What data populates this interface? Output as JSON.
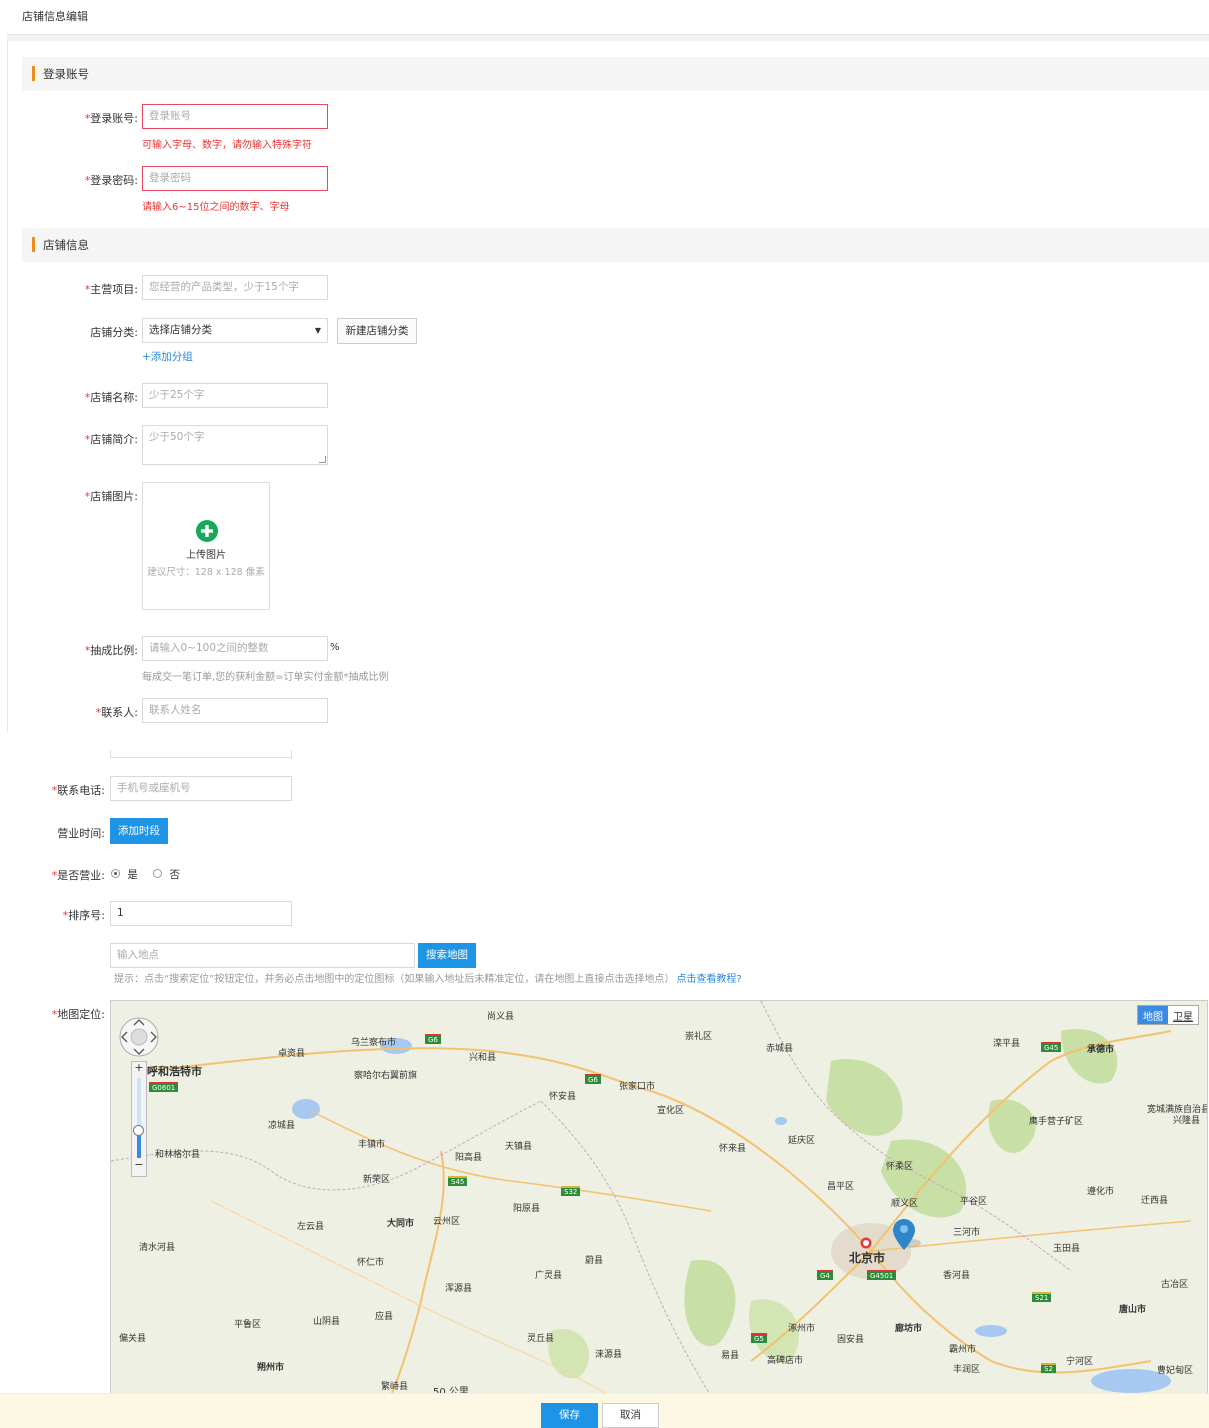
{
  "page": {
    "title": "店铺信息编辑"
  },
  "sections": {
    "login": "登录账号",
    "shop": "店铺信息"
  },
  "fields": {
    "login_account": {
      "label": "登录账号:",
      "placeholder": "登录账号",
      "hint": "可输入字母、数字，请勿输入特殊字符"
    },
    "login_password": {
      "label": "登录密码:",
      "placeholder": "登录密码",
      "hint": "请输入6~15位之间的数字、字母"
    },
    "main_project": {
      "label": "主营项目:",
      "placeholder": "您经营的产品类型，少于15个字"
    },
    "shop_category": {
      "label": "店铺分类:",
      "selected": "选择店铺分类",
      "new_button": "新建店铺分类",
      "add_group": "+添加分组"
    },
    "shop_name": {
      "label": "店铺名称:",
      "placeholder": "少于25个字"
    },
    "shop_intro": {
      "label": "店铺简介:",
      "placeholder": "少于50个字"
    },
    "shop_image": {
      "label": "店铺图片:",
      "upload": "上传图片",
      "size_hint": "建议尺寸：128 x 128 像素"
    },
    "commission": {
      "label": "抽成比例:",
      "placeholder": "请输入0~100之间的整数",
      "unit": "%",
      "hint": "每成交一笔订单,您的获利金额=订单实付金额*抽成比例"
    },
    "contact": {
      "label": "联系人:",
      "placeholder": "联系人姓名"
    },
    "phone": {
      "label": "联系电话:",
      "placeholder": "手机号或座机号"
    },
    "business_hours": {
      "label": "营业时间:",
      "button": "添加时段"
    },
    "is_open": {
      "label": "是否营业:",
      "yes": "是",
      "no": "否"
    },
    "sort": {
      "label": "排序号:",
      "value": "1"
    },
    "map_search": {
      "placeholder": "输入地点",
      "button": "搜索地图",
      "tip": "提示：点击“搜索定位”按钮定位，并务必点击地图中的定位图标（如果输入地址后未精准定位，请在地图上直接点击选择地点）",
      "tutorial": "点击查看教程?"
    },
    "map": {
      "label": "地图定位:"
    }
  },
  "map": {
    "type_map": "地图",
    "type_satellite": "卫星",
    "scale": "50 公里",
    "places": [
      {
        "name": "乌兰察布市"
      },
      {
        "name": "呼和浩特市"
      },
      {
        "name": "卓资县"
      },
      {
        "name": "兴和县"
      },
      {
        "name": "察哈尔右翼前旗"
      },
      {
        "name": "张家口市"
      },
      {
        "name": "怀安县"
      },
      {
        "name": "宣化区"
      },
      {
        "name": "崇礼区"
      },
      {
        "name": "赤城县"
      },
      {
        "name": "滦平县"
      },
      {
        "name": "承德市"
      },
      {
        "name": "凉城县"
      },
      {
        "name": "丰镇市"
      },
      {
        "name": "天镇县"
      },
      {
        "name": "阳高县"
      },
      {
        "name": "和林格尔县"
      },
      {
        "name": "新荣区"
      },
      {
        "name": "大同市"
      },
      {
        "name": "云州区"
      },
      {
        "name": "左云县"
      },
      {
        "name": "清水河县"
      },
      {
        "name": "怀仁市"
      },
      {
        "name": "浑源县"
      },
      {
        "name": "广灵县"
      },
      {
        "name": "蔚县"
      },
      {
        "name": "怀来县"
      },
      {
        "name": "延庆区"
      },
      {
        "name": "怀柔区"
      },
      {
        "name": "昌平区"
      },
      {
        "name": "顺义区"
      },
      {
        "name": "平谷区"
      },
      {
        "name": "三河市"
      },
      {
        "name": "北京市"
      },
      {
        "name": "香河县"
      },
      {
        "name": "玉田县"
      },
      {
        "name": "廊坊市"
      },
      {
        "name": "涿州市"
      },
      {
        "name": "固安县"
      },
      {
        "name": "霸州市"
      },
      {
        "name": "高碑店市"
      },
      {
        "name": "易县"
      },
      {
        "name": "涞源县"
      },
      {
        "name": "灵丘县"
      },
      {
        "name": "应县"
      },
      {
        "name": "山阴县"
      },
      {
        "name": "平鲁区"
      },
      {
        "name": "偏关县"
      },
      {
        "name": "朔州市"
      },
      {
        "name": "繁峙县"
      },
      {
        "name": "阳原县"
      },
      {
        "name": "遵化市"
      },
      {
        "name": "迁西县"
      },
      {
        "name": "唐山市"
      },
      {
        "name": "宁河区"
      },
      {
        "name": "丰润区"
      },
      {
        "name": "古冶区"
      },
      {
        "name": "尚义县"
      },
      {
        "name": "兴隆县"
      },
      {
        "name": "宽城满族自治县"
      },
      {
        "name": "鹰手营子矿区"
      },
      {
        "name": "曹妃甸区"
      }
    ],
    "roads": [
      {
        "name": "G6"
      },
      {
        "name": "G0601"
      },
      {
        "name": "G6"
      },
      {
        "name": "S45"
      },
      {
        "name": "S32"
      },
      {
        "name": "G45"
      },
      {
        "name": "G4"
      },
      {
        "name": "G4501"
      },
      {
        "name": "S21"
      },
      {
        "name": "G5"
      },
      {
        "name": "S2"
      }
    ]
  },
  "footer": {
    "save": "保存",
    "cancel": "取消"
  }
}
